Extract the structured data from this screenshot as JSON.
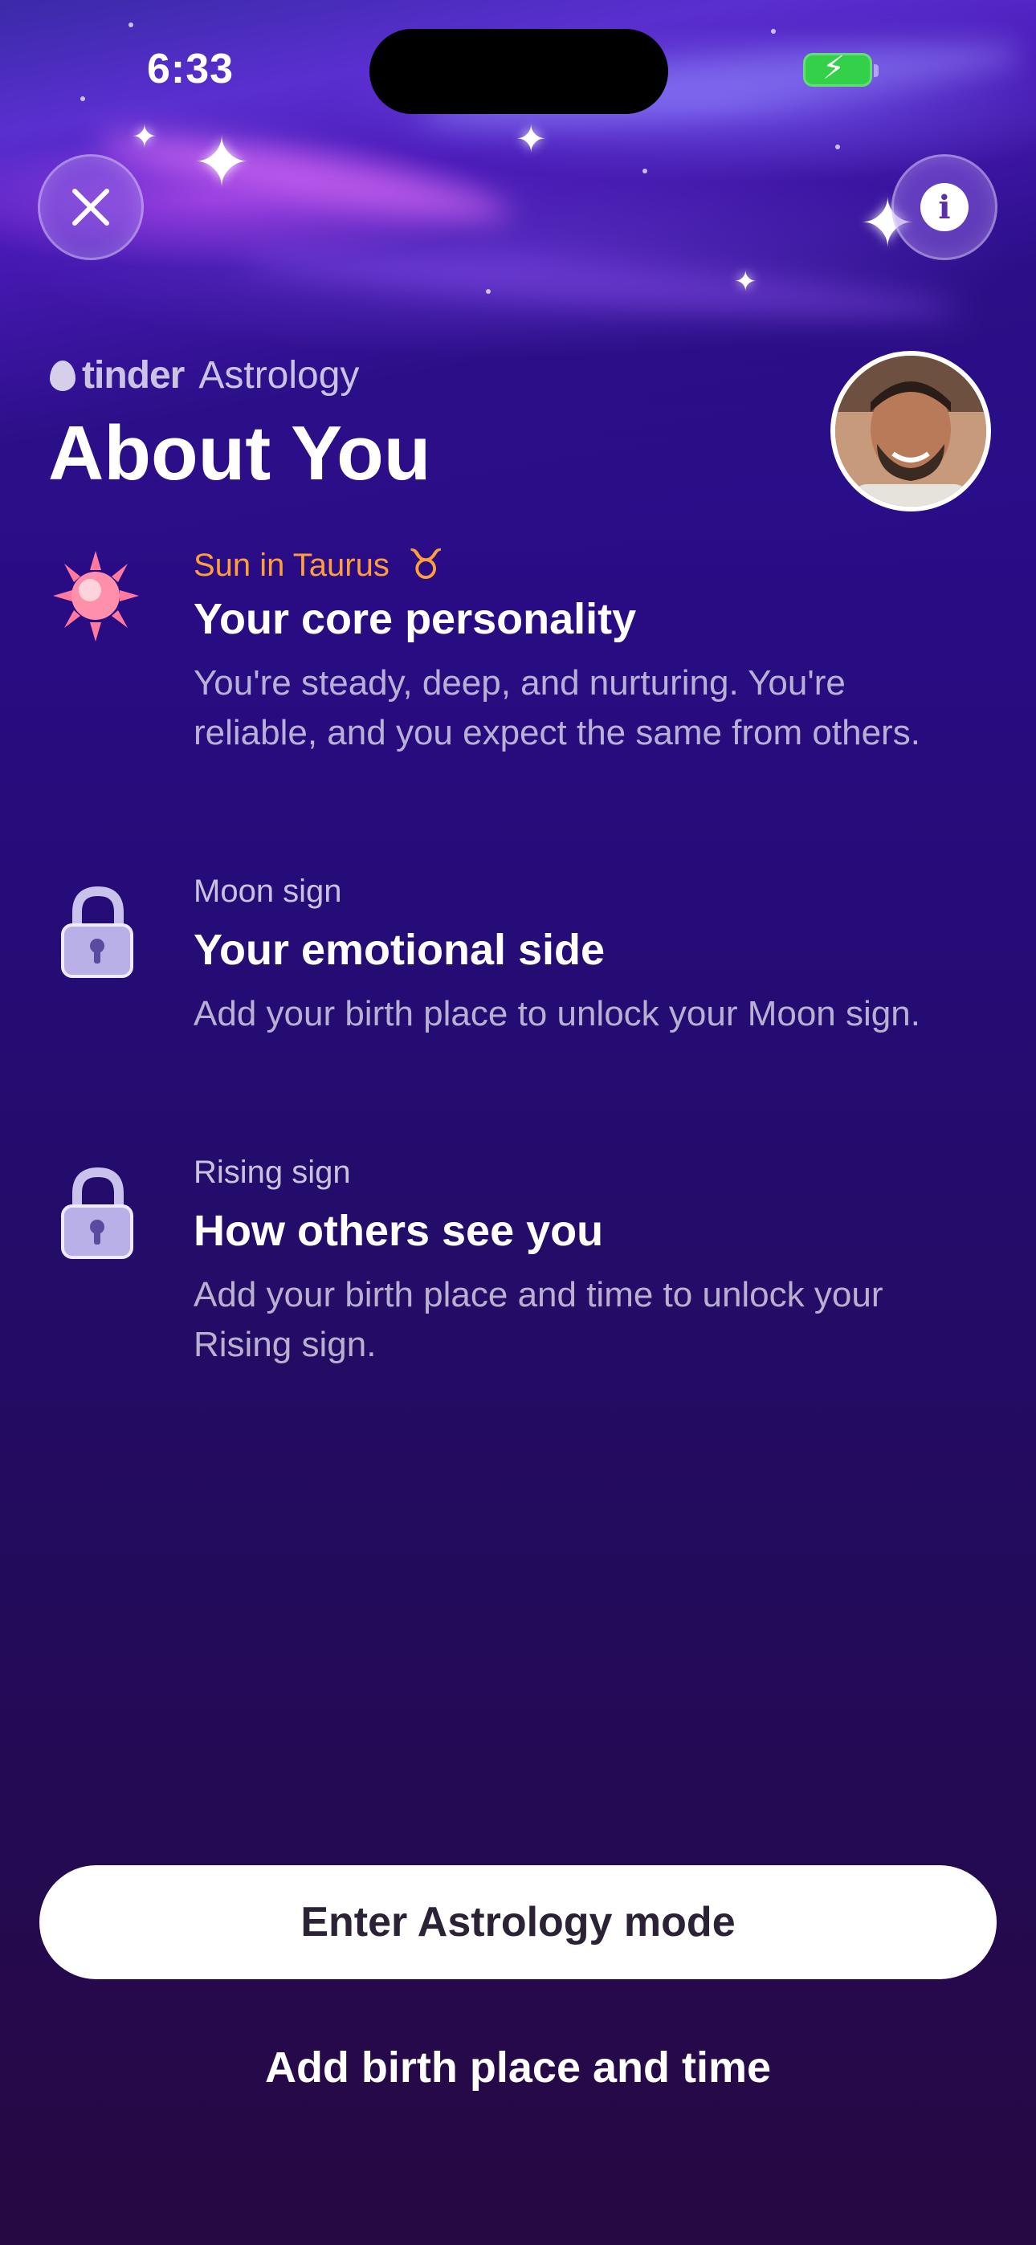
{
  "status_bar": {
    "time": "6:33"
  },
  "header": {
    "brand_name": "tinder",
    "brand_product": "Astrology",
    "title": "About You"
  },
  "icons": {
    "close": "close-icon",
    "info": "info-icon",
    "sun": "sun-icon",
    "lock": "lock-icon",
    "taurus": "taurus-glyph-icon",
    "flame": "flame-icon"
  },
  "sections": [
    {
      "eyebrow": "Sun in Taurus",
      "title": "Your core personality",
      "body": "You're steady, deep, and nurturing. You're reliable, and you expect the same from others."
    },
    {
      "eyebrow": "Moon sign",
      "title": "Your emotional side",
      "body": "Add your birth place to unlock your Moon sign."
    },
    {
      "eyebrow": "Rising sign",
      "title": "How others see you",
      "body": "Add your birth place and time to unlock your Rising sign."
    }
  ],
  "actions": {
    "primary": "Enter Astrology mode",
    "secondary": "Add birth place and time"
  },
  "colors": {
    "accent": "#ff9f3a",
    "background_top": "#2a0e7a",
    "background_bottom": "#260842",
    "battery": "#33d14a"
  }
}
